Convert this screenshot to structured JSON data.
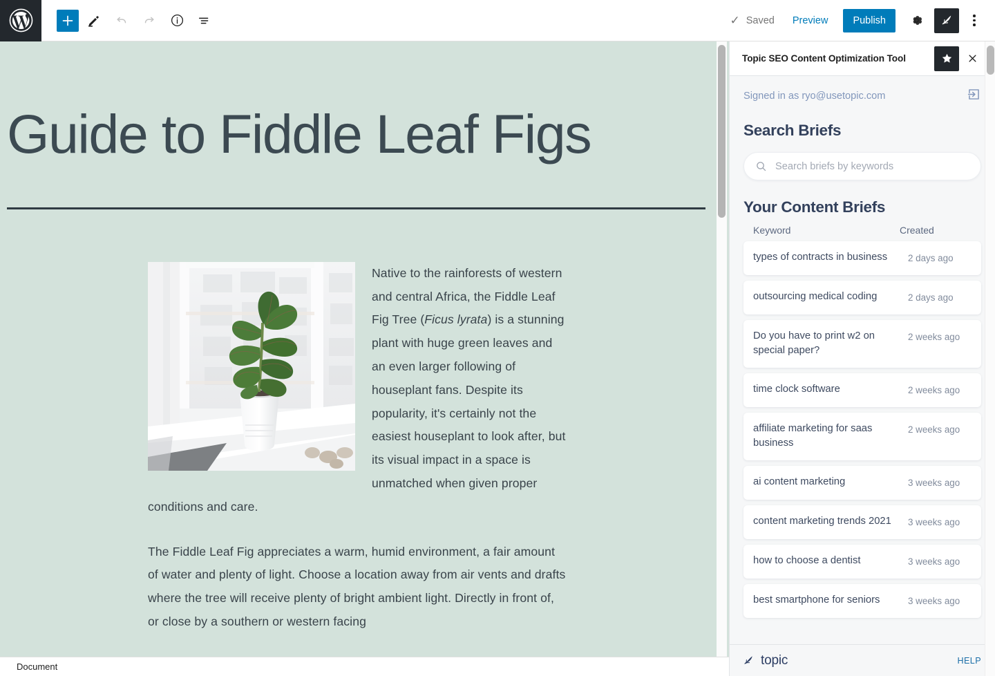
{
  "toolbar": {
    "logo_icon": "wordpress-logo-icon",
    "add_block_label": "+",
    "add_block_icon": "plus-icon",
    "edit_icon": "pencil-icon",
    "undo_icon": "undo-arrow-icon",
    "redo_icon": "redo-arrow-icon",
    "info_icon": "info-circle-icon",
    "list_view_icon": "list-view-icon",
    "saved_label": "Saved",
    "saved_check_icon": "checkmark-icon",
    "preview_label": "Preview",
    "publish_label": "Publish",
    "settings_icon": "gear-icon",
    "plugin_icon": "feather-icon",
    "more_icon": "kebab-menu-icon"
  },
  "editor": {
    "title": "Guide to Fiddle Leaf Figs",
    "image_alt": "fiddle-leaf-fig-plant-on-windowsill",
    "paragraph_1_parts": [
      "Native to the rainforests of western and central Africa, the Fiddle Leaf Fig Tree (",
      "Ficus lyrata",
      ") is a stunning plant with huge green leaves and an even larger following of houseplant fans. Despite its popularity, it's certainly not the easiest houseplant to look after, but its visual impact in a space is unmatched when given proper conditions and care."
    ],
    "paragraph_2": "The Fiddle Leaf Fig appreciates a warm, humid environment, a fair amount of water and plenty of light. Choose a location away from air vents and drafts where the tree will receive plenty of bright ambient light. Directly in front of, or close by a southern or western facing",
    "background_color": "#d3e2db",
    "text_color": "#39434a"
  },
  "statusbar": {
    "document_label": "Document"
  },
  "sidebar": {
    "title": "Topic SEO Content Optimization Tool",
    "star_icon": "star-icon",
    "close_icon": "close-icon",
    "signed_in_text": "Signed in as ryo@usetopic.com",
    "logout_icon": "logout-icon",
    "search_heading": "Search Briefs",
    "search_icon": "search-icon",
    "search_placeholder": "Search briefs by keywords",
    "search_value": "",
    "briefs_heading": "Your Content Briefs",
    "columns": {
      "keyword": "Keyword",
      "created": "Created"
    },
    "briefs": [
      {
        "keyword": "types of contracts in business",
        "created": "2 days ago"
      },
      {
        "keyword": "outsourcing medical coding",
        "created": "2 days ago"
      },
      {
        "keyword": "Do you have to print w2 on special paper?",
        "created": "2 weeks ago"
      },
      {
        "keyword": "time clock software",
        "created": "2 weeks ago"
      },
      {
        "keyword": "affiliate marketing for saas business",
        "created": "2 weeks ago"
      },
      {
        "keyword": "ai content marketing",
        "created": "3 weeks ago"
      },
      {
        "keyword": "content marketing trends 2021",
        "created": "3 weeks ago"
      },
      {
        "keyword": "how to choose a dentist",
        "created": "3 weeks ago"
      },
      {
        "keyword": "best smartphone for seniors",
        "created": "3 weeks ago"
      }
    ],
    "footer": {
      "logo_icon": "feather-icon",
      "logo_text": "topic",
      "help_label": "HELP"
    }
  },
  "colors": {
    "accent_blue": "#007cba",
    "dark": "#23282d",
    "canvas_green": "#d3e2db",
    "sidebar_bg": "#f6f7f8",
    "heading_navy": "#33415c"
  }
}
